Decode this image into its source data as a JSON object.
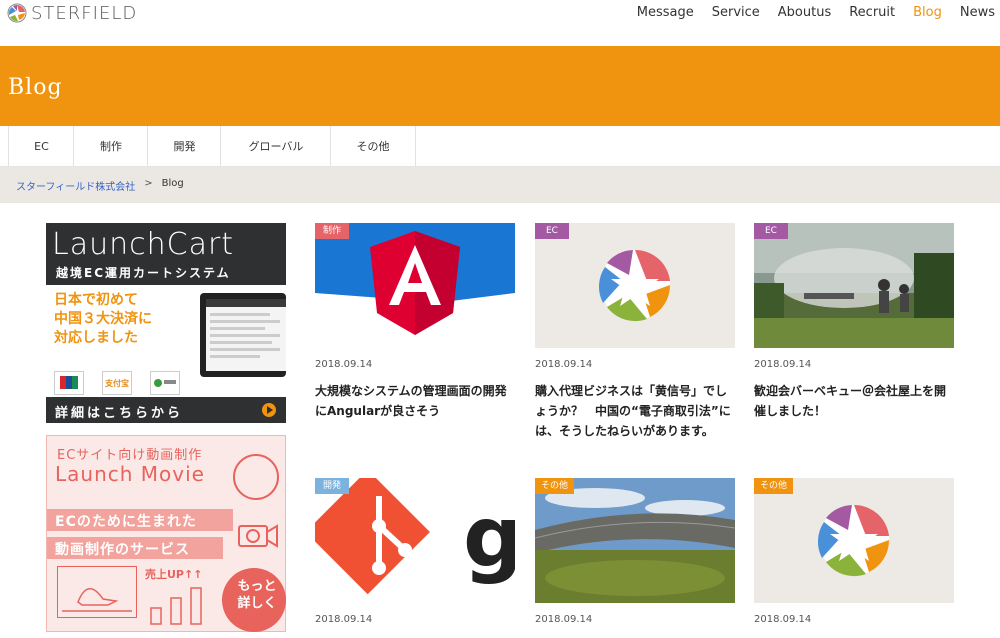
{
  "header": {
    "logo_text": "STERFIELD",
    "nav": [
      {
        "label": "Message",
        "active": false
      },
      {
        "label": "Service",
        "active": false
      },
      {
        "label": "Aboutus",
        "active": false
      },
      {
        "label": "Recruit",
        "active": false
      },
      {
        "label": "Blog",
        "active": true
      },
      {
        "label": "News",
        "active": false
      }
    ]
  },
  "banner": {
    "title": "Blog"
  },
  "categories": [
    "EC",
    "制作",
    "開発",
    "グローバル",
    "その他"
  ],
  "breadcrumb": {
    "home": "スターフィールド株式会社",
    "separator": ">",
    "current": "Blog"
  },
  "sidebar": {
    "ad1": {
      "title": "LaunchCart",
      "subtitle": "越境EC運用カートシステム",
      "headline": "日本で初めて\n中国３大決済に\n対応しました",
      "more": "詳細はこちらから"
    },
    "ad2": {
      "line1": "ECサイト向け動画制作",
      "line2": "Launch Movie",
      "band1": "ECのために生まれた",
      "band2": "動画制作のサービス",
      "up": "売上UP↑↑",
      "circle": "もっと\n詳しく"
    }
  },
  "posts": [
    {
      "tag": "制作",
      "tag_color": "#e5646a",
      "date": "2018.09.14",
      "title": "大規模なシステムの管理画面の開発にAngularが良さそう",
      "thumb": "angular"
    },
    {
      "tag": "EC",
      "tag_color": "#a35aa3",
      "date": "2018.09.14",
      "title": "購入代理ビジネスは「黄信号」でしょうか？　中国の“電子商取引法”には、そうしたねらいがあります。",
      "thumb": "star"
    },
    {
      "tag": "EC",
      "tag_color": "#a35aa3",
      "date": "2018.09.14",
      "title": "歓迎会バーベキュー＠会社屋上を開催しました！",
      "thumb": "bbq"
    },
    {
      "tag": "開発",
      "tag_color": "#7cb3de",
      "date": "2018.09.14",
      "title": "",
      "thumb": "git"
    },
    {
      "tag": "その他",
      "tag_color": "#f0930e",
      "date": "2018.09.14",
      "title": "",
      "thumb": "building"
    },
    {
      "tag": "その他",
      "tag_color": "#f0930e",
      "date": "2018.09.14",
      "title": "",
      "thumb": "star"
    }
  ]
}
